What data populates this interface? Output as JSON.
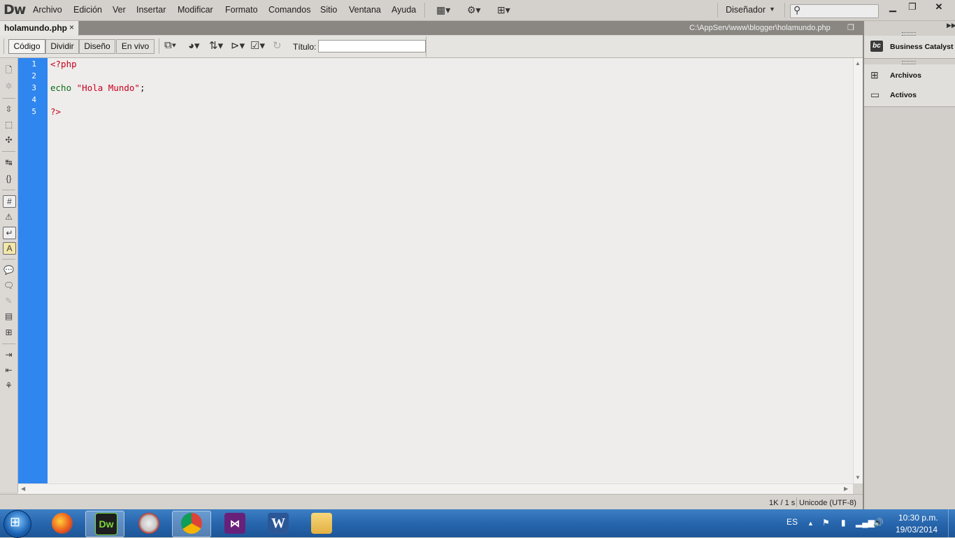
{
  "app": {
    "logo": "Dw"
  },
  "menubar": {
    "items": [
      "Archivo",
      "Edición",
      "Ver",
      "Insertar",
      "Modificar",
      "Formato",
      "Comandos",
      "Sitio",
      "Ventana",
      "Ayuda"
    ],
    "workspace": "Diseñador",
    "search_placeholder": ""
  },
  "document_tab": {
    "filename": "holamundo.php",
    "close": "×",
    "path": "C:\\AppServ\\www\\blogger\\holamundo.php"
  },
  "doc_toolbar": {
    "views": [
      "Código",
      "Dividir",
      "Diseño",
      "En vivo"
    ],
    "active_view": "Código",
    "title_label": "Título:",
    "title_value": ""
  },
  "editor": {
    "line_numbers": [
      "1",
      "2",
      "3",
      "4",
      "5"
    ],
    "lines": {
      "l1": "<?php",
      "l3_keyword": "echo",
      "l3_string": "\"Hola Mundo\"",
      "l3_end": ";",
      "l5": "?>"
    },
    "colors": {
      "gutter": "#2f86ef",
      "php_tag": "#c8001f",
      "keyword": "#0a6d19"
    }
  },
  "statusbar": {
    "size": "1K / 1 s",
    "encoding": "Unicode (UTF-8)"
  },
  "right_panel": {
    "business_catalyst": "Business Catalyst",
    "bc_icon_text": "bc",
    "archivos": "Archivos",
    "activos": "Activos"
  },
  "taskbar": {
    "apps": [
      "firefox",
      "dreamweaver",
      "ccleaner",
      "chrome",
      "visual-studio",
      "word",
      "file-explorer"
    ],
    "dw_icon": "Dw",
    "word_icon": "W",
    "lang": "ES",
    "time": "10:30 p.m.",
    "date": "19/03/2014"
  }
}
